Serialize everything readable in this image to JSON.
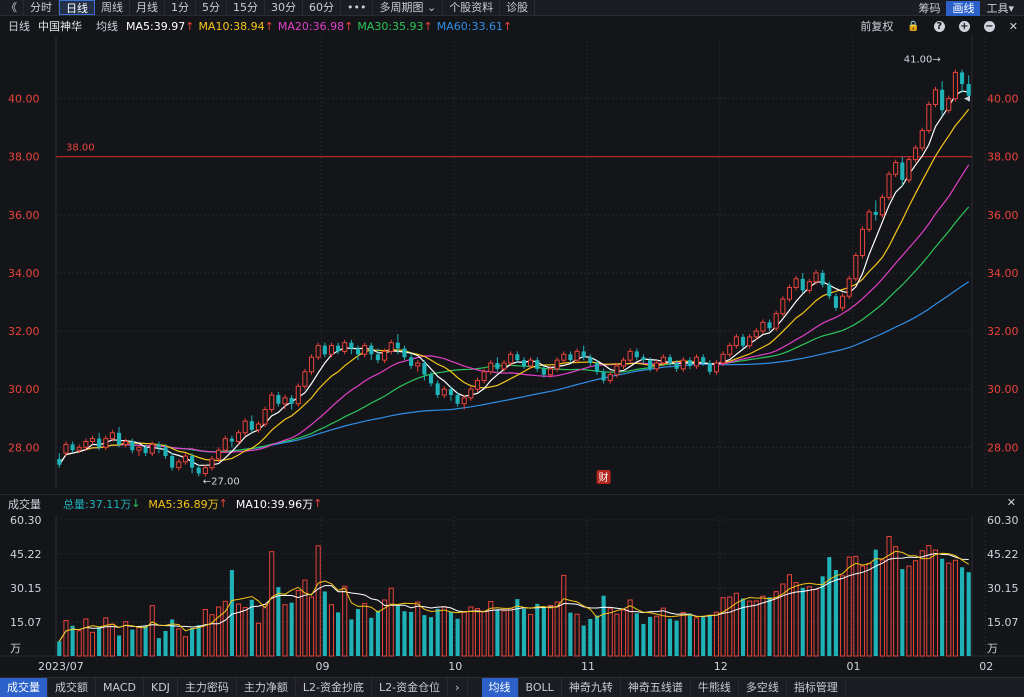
{
  "toolbar": {
    "back": "《",
    "periods": [
      "分时",
      "日线",
      "周线",
      "月线",
      "1分",
      "5分",
      "15分",
      "30分",
      "60分",
      "•••",
      "多周期图 ⌄",
      "个股资料",
      "诊股"
    ],
    "active_index": 1,
    "right": [
      "筹码",
      "画线",
      "工具▾"
    ],
    "right_active_index": 1
  },
  "info": {
    "period": "日线",
    "name": "中国神华",
    "avg": "均线",
    "ma5": "MA5:39.97",
    "ma10": "MA10:38.94",
    "ma20": "MA20:36.98",
    "ma30": "MA30:35.93",
    "ma60": "MA60:33.61",
    "adjust": "前复权"
  },
  "volume_info": {
    "title": "成交量",
    "total": "总量:37.11万",
    "ma5": "MA5:36.89万",
    "ma10": "MA10:39.96万"
  },
  "bottom_tabs": [
    "成交量",
    "成交额",
    "MACD",
    "KDJ",
    "主力密码",
    "主力净额",
    "L2-资金抄底",
    "L2-资金仓位"
  ],
  "bottom_active": 0,
  "bottom_tabs2": [
    "均线",
    "BOLL",
    "神奇九转",
    "神奇五线谱",
    "牛熊线",
    "多空线",
    "指标管理"
  ],
  "bottom2_active": 0,
  "colors": {
    "up": "#e8433b",
    "down": "#1fb3b8",
    "ma5": "#ffffff",
    "ma10": "#f5c518",
    "ma20": "#e040c8",
    "ma30": "#2cc55a",
    "ma60": "#2f8fe6",
    "hline": "#c62828"
  },
  "chart_data": {
    "type": "candlestick",
    "price_axis": {
      "ylim": [
        26.6,
        41.5
      ],
      "ticks": [
        "40.00",
        "38.00",
        "36.00",
        "34.00",
        "32.00",
        "30.00",
        "28.00"
      ],
      "tick_values": [
        40,
        38,
        36,
        34,
        32,
        30,
        28
      ]
    },
    "volume_axis": {
      "ylim": [
        0,
        62
      ],
      "ticks": [
        "60.30",
        "45.22",
        "30.15",
        "15.07",
        "万"
      ],
      "tick_values": [
        60.3,
        45.22,
        30.15,
        15.07,
        0
      ]
    },
    "date_labels": [
      {
        "label": "2023/07",
        "index": 0
      },
      {
        "label": "09",
        "index": 40
      },
      {
        "label": "10",
        "index": 60
      },
      {
        "label": "11",
        "index": 80
      },
      {
        "label": "12",
        "index": 100
      },
      {
        "label": "01",
        "index": 120
      },
      {
        "label": "02",
        "index": 140
      }
    ],
    "horizontal_line": {
      "value": 38.0,
      "label": "38.00"
    },
    "annotations": {
      "high_label": "41.00→",
      "low_label": "←27.00",
      "event_marker": "财"
    },
    "candles": [
      [
        27.6,
        27.4,
        27.8,
        27.3,
        6.5
      ],
      [
        27.8,
        28.1,
        28.2,
        27.7,
        15.7
      ],
      [
        28.1,
        27.9,
        28.2,
        27.8,
        13.4
      ],
      [
        27.9,
        28.0,
        28.1,
        27.8,
        11.2
      ],
      [
        28.0,
        28.2,
        28.3,
        27.9,
        16.4
      ],
      [
        28.2,
        28.3,
        28.4,
        28.1,
        10.5
      ],
      [
        28.3,
        28.0,
        28.5,
        27.9,
        12.8
      ],
      [
        28.0,
        28.3,
        28.4,
        27.9,
        16.9
      ],
      [
        28.3,
        28.5,
        28.6,
        28.2,
        14.1
      ],
      [
        28.5,
        28.1,
        28.7,
        28.0,
        9.1
      ],
      [
        28.1,
        28.2,
        28.3,
        28.0,
        15.2
      ],
      [
        28.2,
        27.9,
        28.3,
        27.8,
        11.7
      ],
      [
        27.9,
        28.0,
        28.1,
        27.7,
        12.9
      ],
      [
        28.0,
        27.8,
        28.1,
        27.7,
        13.5
      ],
      [
        27.8,
        28.1,
        28.2,
        27.7,
        22.3
      ],
      [
        28.1,
        28.0,
        28.2,
        27.8,
        7.9
      ],
      [
        28.0,
        27.7,
        28.1,
        27.6,
        11.1
      ],
      [
        27.7,
        27.3,
        27.8,
        27.2,
        16.2
      ],
      [
        27.3,
        27.5,
        27.6,
        27.2,
        12.0
      ],
      [
        27.5,
        27.7,
        27.8,
        27.4,
        8.5
      ],
      [
        27.7,
        27.3,
        27.8,
        27.1,
        12.4
      ],
      [
        27.3,
        27.1,
        27.4,
        27.0,
        13.7
      ],
      [
        27.1,
        27.3,
        27.4,
        27.0,
        20.6
      ],
      [
        27.3,
        27.6,
        27.7,
        27.2,
        18.3
      ],
      [
        27.6,
        27.9,
        28.0,
        27.5,
        21.7
      ],
      [
        27.9,
        28.3,
        28.4,
        27.8,
        24.2
      ],
      [
        28.3,
        28.2,
        28.4,
        28.0,
        38.1
      ],
      [
        28.2,
        28.5,
        28.6,
        28.1,
        23.0
      ],
      [
        28.5,
        28.9,
        29.0,
        28.4,
        21.5
      ],
      [
        28.9,
        28.6,
        29.1,
        28.5,
        24.9
      ],
      [
        28.6,
        28.8,
        28.9,
        28.5,
        14.5
      ],
      [
        28.8,
        29.3,
        29.4,
        28.7,
        22.8
      ],
      [
        29.3,
        29.8,
        29.9,
        29.2,
        46.2
      ],
      [
        29.8,
        29.5,
        29.9,
        29.4,
        30.5
      ],
      [
        29.5,
        29.7,
        29.8,
        29.3,
        22.7
      ],
      [
        29.7,
        29.5,
        29.8,
        29.3,
        23.6
      ],
      [
        29.5,
        30.1,
        30.2,
        29.4,
        29.0
      ],
      [
        30.1,
        30.6,
        30.7,
        30.0,
        33.6
      ],
      [
        30.6,
        31.1,
        31.2,
        30.5,
        26.1
      ],
      [
        31.1,
        31.5,
        31.6,
        31.0,
        48.8
      ],
      [
        31.5,
        31.2,
        31.6,
        31.1,
        28.6
      ],
      [
        31.2,
        31.5,
        31.6,
        31.1,
        22.7
      ],
      [
        31.5,
        31.3,
        31.6,
        31.2,
        19.3
      ],
      [
        31.3,
        31.6,
        31.7,
        31.2,
        30.9
      ],
      [
        31.6,
        31.4,
        31.7,
        31.2,
        16.2
      ],
      [
        31.4,
        31.2,
        31.5,
        31.0,
        20.8
      ],
      [
        31.2,
        31.5,
        31.6,
        31.1,
        23.2
      ],
      [
        31.5,
        31.2,
        31.6,
        31.0,
        16.9
      ],
      [
        31.2,
        31.0,
        31.4,
        30.9,
        20.1
      ],
      [
        31.0,
        31.3,
        31.4,
        30.9,
        24.8
      ],
      [
        31.3,
        31.6,
        31.7,
        31.2,
        30.0
      ],
      [
        31.6,
        31.4,
        31.9,
        31.2,
        22.2
      ],
      [
        31.4,
        31.1,
        31.5,
        31.0,
        19.8
      ],
      [
        31.1,
        30.8,
        31.2,
        30.7,
        19.5
      ],
      [
        30.8,
        30.9,
        31.0,
        30.6,
        23.9
      ],
      [
        30.9,
        30.5,
        31.0,
        30.3,
        18.1
      ],
      [
        30.5,
        30.2,
        30.6,
        30.1,
        17.2
      ],
      [
        30.2,
        29.8,
        30.3,
        29.7,
        20.9
      ],
      [
        29.8,
        30.0,
        30.1,
        29.7,
        21.8
      ],
      [
        30.0,
        29.8,
        30.1,
        29.6,
        19.4
      ],
      [
        29.8,
        29.5,
        29.9,
        29.4,
        16.5
      ],
      [
        29.5,
        29.7,
        29.8,
        29.3,
        19.3
      ],
      [
        29.7,
        30.0,
        30.1,
        29.6,
        21.7
      ],
      [
        30.0,
        30.3,
        30.4,
        29.9,
        21.0
      ],
      [
        30.3,
        30.6,
        30.7,
        30.2,
        19.8
      ],
      [
        30.6,
        30.9,
        31.0,
        30.5,
        24.1
      ],
      [
        30.9,
        30.7,
        31.1,
        30.6,
        20.4
      ],
      [
        30.7,
        30.9,
        31.0,
        30.6,
        20.0
      ],
      [
        30.9,
        31.2,
        31.3,
        30.8,
        21.1
      ],
      [
        31.2,
        31.0,
        31.3,
        30.9,
        25.2
      ],
      [
        31.0,
        30.8,
        31.1,
        30.7,
        20.9
      ],
      [
        30.8,
        31.0,
        31.1,
        30.7,
        18.4
      ],
      [
        31.0,
        30.7,
        31.1,
        30.6,
        23.1
      ],
      [
        30.7,
        30.5,
        30.8,
        30.4,
        21.8
      ],
      [
        30.5,
        30.7,
        30.8,
        30.4,
        22.4
      ],
      [
        30.7,
        31.0,
        31.1,
        30.6,
        23.9
      ],
      [
        31.0,
        31.2,
        31.3,
        30.9,
        35.7
      ],
      [
        31.2,
        31.0,
        31.3,
        30.9,
        19.2
      ],
      [
        31.0,
        31.3,
        31.4,
        30.9,
        18.5
      ],
      [
        31.3,
        31.1,
        31.5,
        31.0,
        13.5
      ],
      [
        31.1,
        30.9,
        31.2,
        30.8,
        16.4
      ],
      [
        30.9,
        30.6,
        31.0,
        30.5,
        17.9
      ],
      [
        30.6,
        30.3,
        30.7,
        30.2,
        26.7
      ],
      [
        30.3,
        30.5,
        30.6,
        30.2,
        20.9
      ],
      [
        30.5,
        30.8,
        30.9,
        30.4,
        18.5
      ],
      [
        30.8,
        31.0,
        31.1,
        30.7,
        20.4
      ],
      [
        31.0,
        31.3,
        31.4,
        30.9,
        24.8
      ],
      [
        31.3,
        31.1,
        31.4,
        31.0,
        18.9
      ],
      [
        31.1,
        31.0,
        31.2,
        30.9,
        14.2
      ],
      [
        31.0,
        30.7,
        31.1,
        30.6,
        17.3
      ],
      [
        30.7,
        30.9,
        31.0,
        30.6,
        17.6
      ],
      [
        30.9,
        31.1,
        31.2,
        30.8,
        21.2
      ],
      [
        31.1,
        30.9,
        31.2,
        30.8,
        16.5
      ],
      [
        30.9,
        30.7,
        31.0,
        30.6,
        15.7
      ],
      [
        30.7,
        31.0,
        31.1,
        30.6,
        19.3
      ],
      [
        31.0,
        30.8,
        31.1,
        30.7,
        18.8
      ],
      [
        30.8,
        31.1,
        31.2,
        30.7,
        16.9
      ],
      [
        31.1,
        30.9,
        31.2,
        30.8,
        17.2
      ],
      [
        30.9,
        30.6,
        31.0,
        30.5,
        18.2
      ],
      [
        30.6,
        30.9,
        31.0,
        30.5,
        19.4
      ],
      [
        30.9,
        31.2,
        31.3,
        30.8,
        25.8
      ],
      [
        31.2,
        31.5,
        31.6,
        31.1,
        26.1
      ],
      [
        31.5,
        31.8,
        31.9,
        31.4,
        27.8
      ],
      [
        31.8,
        31.5,
        31.9,
        31.4,
        25.5
      ],
      [
        31.5,
        31.8,
        31.9,
        31.4,
        24.3
      ],
      [
        31.8,
        32.0,
        32.1,
        31.7,
        24.4
      ],
      [
        32.0,
        32.3,
        32.4,
        31.9,
        26.5
      ],
      [
        32.3,
        32.1,
        32.4,
        32.0,
        26.0
      ],
      [
        32.1,
        32.6,
        32.7,
        32.0,
        28.5
      ],
      [
        32.6,
        33.1,
        33.2,
        32.5,
        31.9
      ],
      [
        33.1,
        33.5,
        33.6,
        33.0,
        36.0
      ],
      [
        33.5,
        33.8,
        33.9,
        33.4,
        32.5
      ],
      [
        33.8,
        33.4,
        34.0,
        33.3,
        30.2
      ],
      [
        33.4,
        33.7,
        33.8,
        33.3,
        30.7
      ],
      [
        33.7,
        34.0,
        34.1,
        33.6,
        29.5
      ],
      [
        34.0,
        33.6,
        34.1,
        33.5,
        35.3
      ],
      [
        33.6,
        33.2,
        33.7,
        33.1,
        43.8
      ],
      [
        33.2,
        32.8,
        33.3,
        32.7,
        38.1
      ],
      [
        32.8,
        33.2,
        33.3,
        32.7,
        35.5
      ],
      [
        33.2,
        33.8,
        33.9,
        33.1,
        43.8
      ],
      [
        33.8,
        34.6,
        34.7,
        33.7,
        44.1
      ],
      [
        34.6,
        35.5,
        35.6,
        34.5,
        39.8
      ],
      [
        35.5,
        36.1,
        36.2,
        35.4,
        41.0
      ],
      [
        36.1,
        36.0,
        36.5,
        35.8,
        47.1
      ],
      [
        36.0,
        36.6,
        36.7,
        35.9,
        42.5
      ],
      [
        36.6,
        37.4,
        37.5,
        36.5,
        52.9
      ],
      [
        37.4,
        37.8,
        37.9,
        37.3,
        48.4
      ],
      [
        37.8,
        37.2,
        38.0,
        37.0,
        38.5
      ],
      [
        37.2,
        37.9,
        38.0,
        37.1,
        39.8
      ],
      [
        37.9,
        38.3,
        38.4,
        37.8,
        42.2
      ],
      [
        38.3,
        38.9,
        39.0,
        38.2,
        46.6
      ],
      [
        38.9,
        39.8,
        39.9,
        38.8,
        48.9
      ],
      [
        39.8,
        40.3,
        40.4,
        39.7,
        46.9
      ],
      [
        40.3,
        39.6,
        40.6,
        39.4,
        43.1
      ],
      [
        39.6,
        40.0,
        40.1,
        39.5,
        41.1
      ],
      [
        40.0,
        40.9,
        41.0,
        39.9,
        42.4
      ],
      [
        40.9,
        40.5,
        41.0,
        40.2,
        39.3
      ],
      [
        40.5,
        40.1,
        40.8,
        39.9,
        37.1
      ]
    ]
  }
}
